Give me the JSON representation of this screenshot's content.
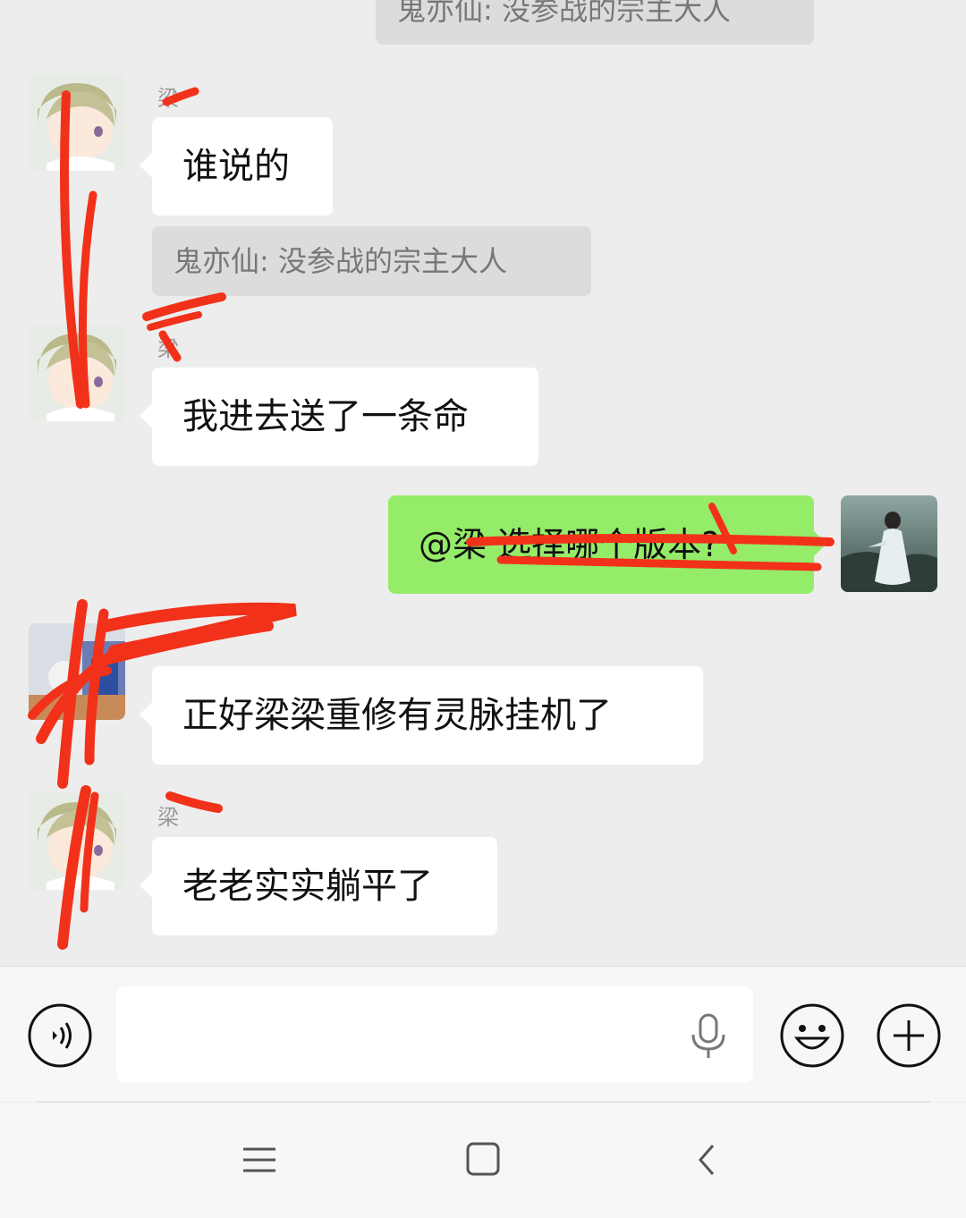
{
  "messages": [
    {
      "type": "quote",
      "text": "鬼亦仙: 没参战的宗主大人"
    },
    {
      "type": "text",
      "sender": "梁",
      "text": "谁说的"
    },
    {
      "type": "quote",
      "text": "鬼亦仙: 没参战的宗主大人"
    },
    {
      "type": "text",
      "sender": "梁",
      "text": "我进去送了一条命"
    },
    {
      "type": "mine",
      "text": "@梁 选择哪个版本?"
    },
    {
      "type": "text",
      "sender": "",
      "text": "正好梁梁重修有灵脉挂机了"
    },
    {
      "type": "text",
      "sender": "梁",
      "text": "老老实实躺平了"
    }
  ],
  "input": {
    "value": "",
    "voice_icon": "voice-toggle-icon",
    "mic_icon": "microphone-icon",
    "emoji_icon": "emoji-icon",
    "plus_icon": "plus-icon"
  },
  "nav": {
    "menu_icon": "menu-icon",
    "home_icon": "home-icon",
    "back_icon": "back-icon"
  },
  "colors": {
    "background": "#ededed",
    "my_bubble": "#95ec69",
    "other_bubble": "#ffffff",
    "quote_bubble": "#dcdcdc",
    "scribble": "#f2311a"
  }
}
